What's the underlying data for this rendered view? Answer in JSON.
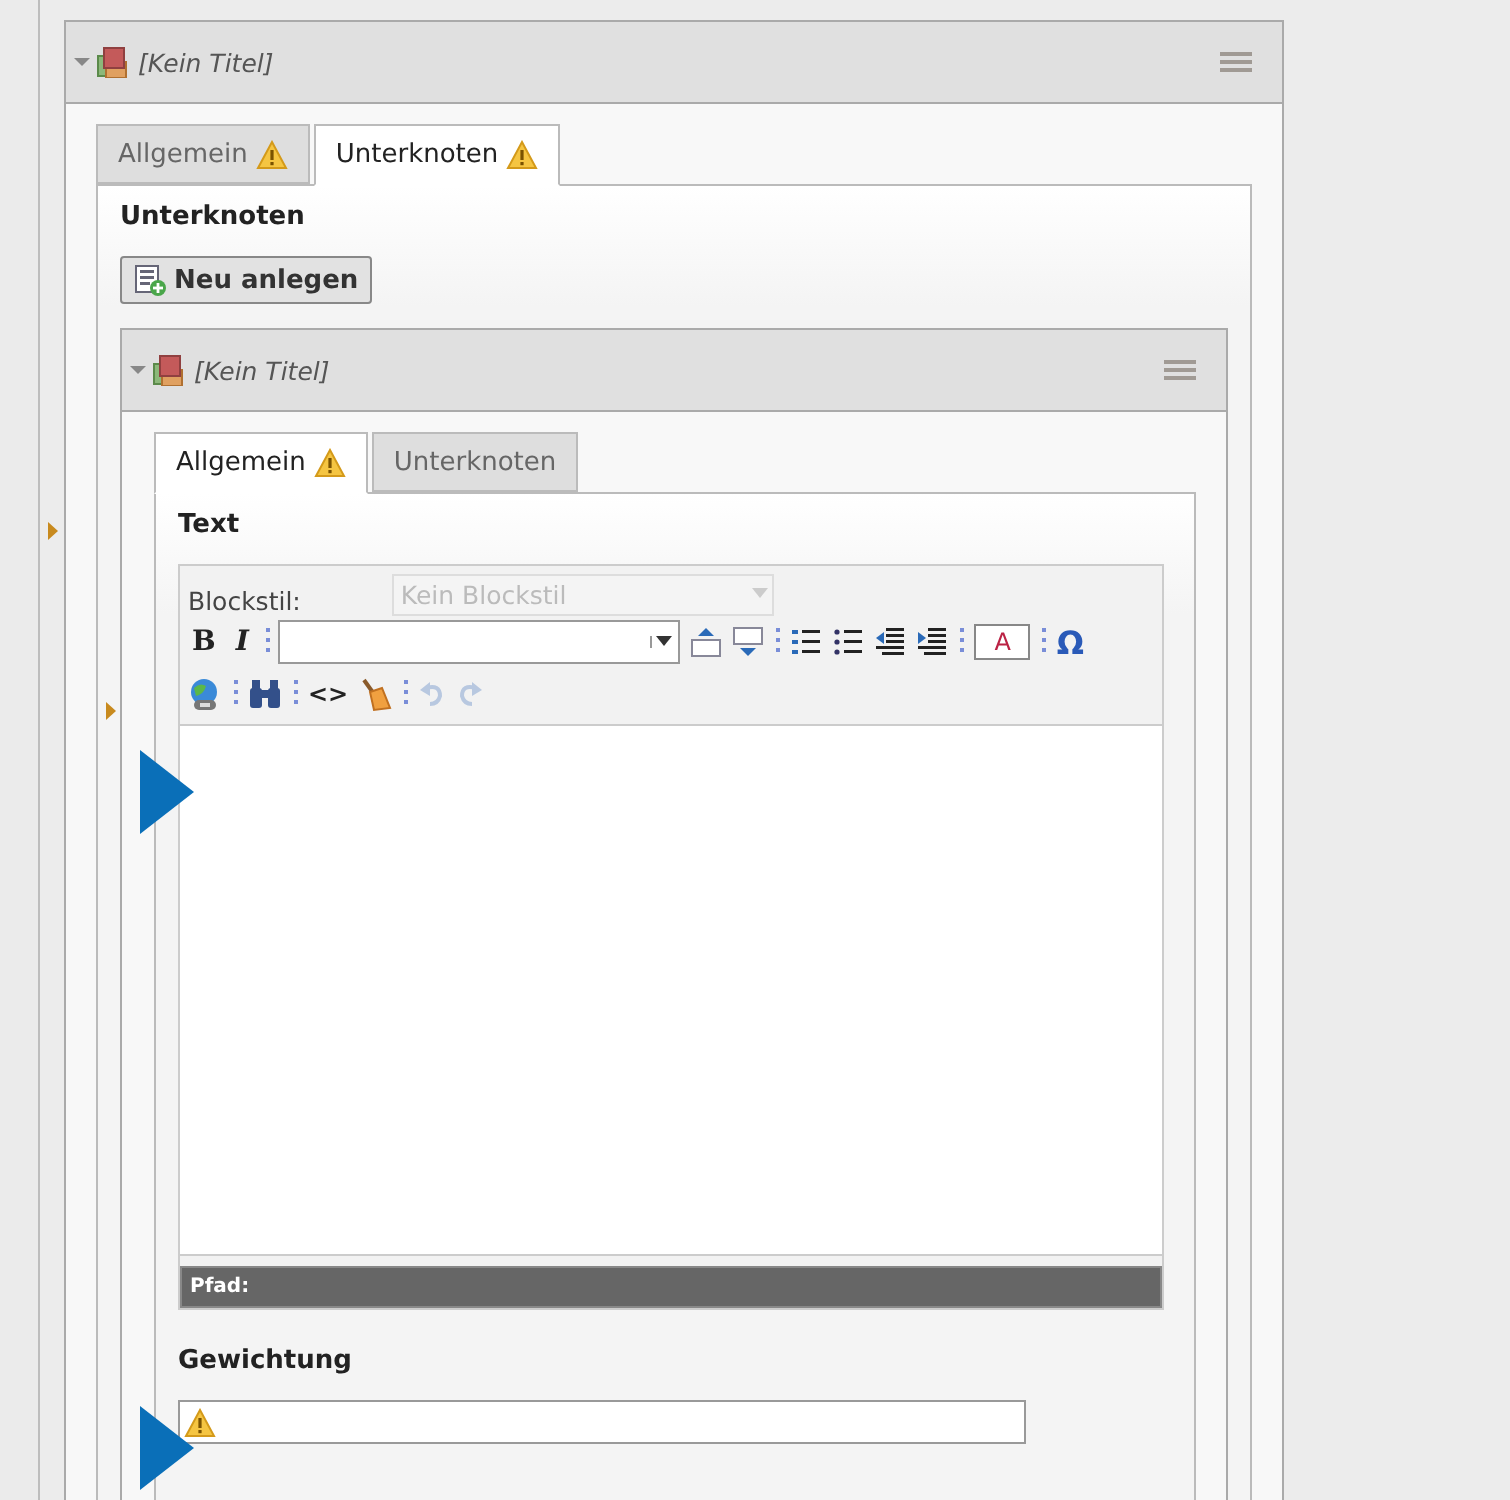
{
  "node": {
    "title": "[Kein Titel]",
    "collapsed": false,
    "tabs": [
      {
        "label": "Allgemein",
        "warning": true,
        "selected": false
      },
      {
        "label": "Unterknoten",
        "warning": true,
        "selected": true
      }
    ],
    "section_title": "Unterknoten",
    "new_button": "Neu anlegen",
    "child": {
      "title": "[Kein Titel]",
      "collapsed": false,
      "tabs": [
        {
          "label": "Allgemein",
          "warning": true,
          "selected": true
        },
        {
          "label": "Unterknoten",
          "warning": false,
          "selected": false
        }
      ],
      "field_label": "Text",
      "editor": {
        "blockstyle_label": "Blockstil:",
        "blockstyle_value": "Kein Blockstil",
        "blockstyle_disabled": true,
        "toolbar_rows": [
          [
            {
              "kind": "bold",
              "label": "B"
            },
            {
              "kind": "italic",
              "label": "I"
            },
            {
              "kind": "sep"
            },
            {
              "kind": "font-select"
            },
            {
              "kind": "block-up"
            },
            {
              "kind": "block-down"
            },
            {
              "kind": "sep"
            },
            {
              "kind": "ordered-list"
            },
            {
              "kind": "bullet-list"
            },
            {
              "kind": "outdent"
            },
            {
              "kind": "indent"
            },
            {
              "kind": "sep"
            },
            {
              "kind": "color",
              "label": "A"
            },
            {
              "kind": "sep"
            },
            {
              "kind": "char",
              "label": "Ω"
            }
          ],
          [
            {
              "kind": "link"
            },
            {
              "kind": "sep"
            },
            {
              "kind": "find"
            },
            {
              "kind": "sep"
            },
            {
              "kind": "source",
              "label": "<>"
            },
            {
              "kind": "clean"
            },
            {
              "kind": "sep"
            },
            {
              "kind": "undo",
              "disabled": true
            },
            {
              "kind": "redo",
              "disabled": true
            }
          ]
        ],
        "path_label": "Pfad:"
      },
      "weight_label": "Gewichtung",
      "weight_warning": true
    }
  }
}
